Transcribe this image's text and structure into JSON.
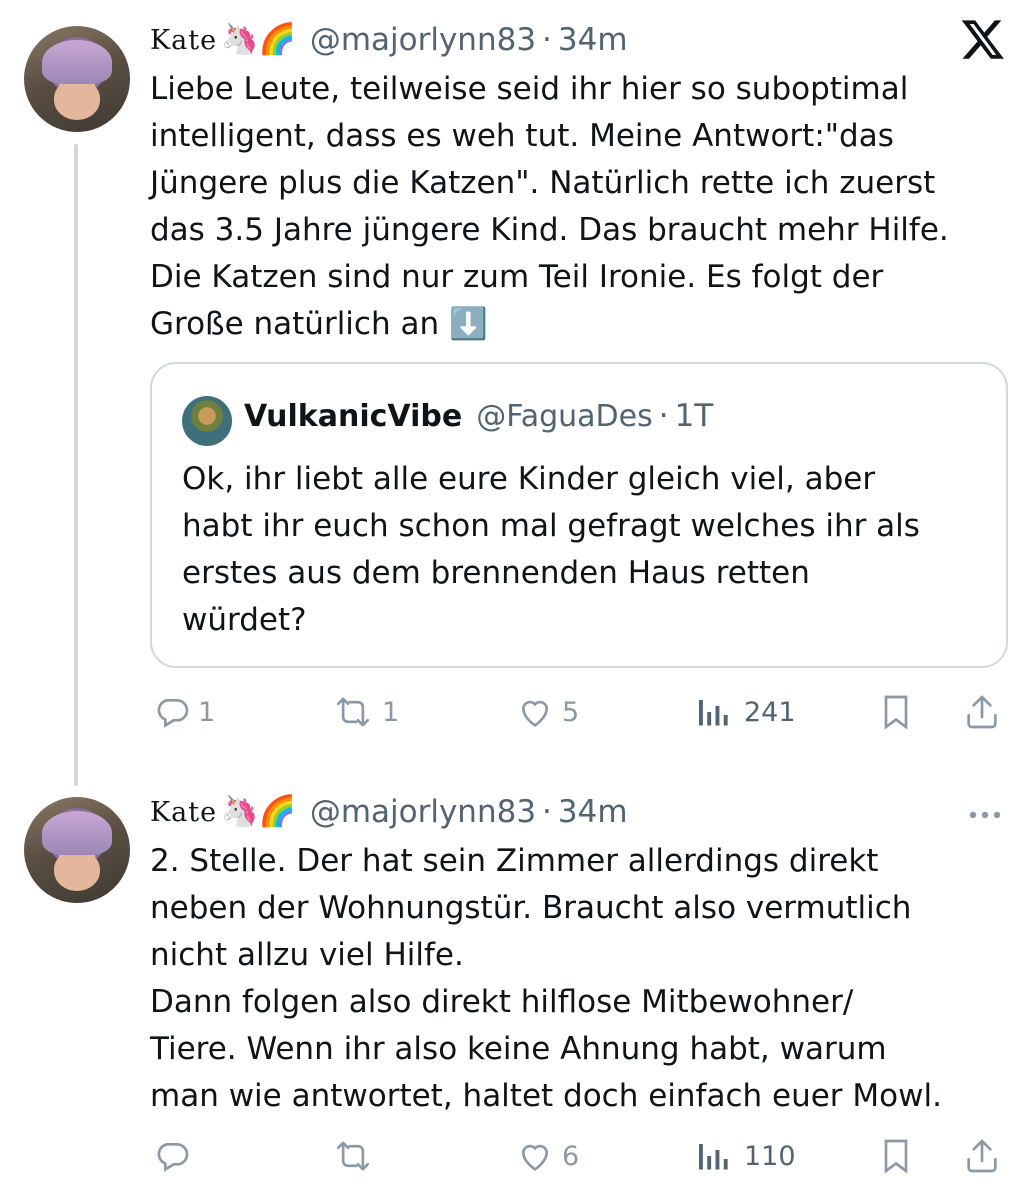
{
  "brand": {
    "logo_icon": "x-logo-icon"
  },
  "tweets": [
    {
      "author_name": "Kate",
      "author_emojis": "🦄🌈",
      "handle": "@majorlynn83",
      "separator": "·",
      "time": "34m",
      "text": "Liebe Leute, teilweise seid ihr hier so suboptimal\nintelligent, dass es weh tut. Meine Antwort:\"das\nJüngere plus die Katzen\". Natürlich rette ich zuerst\ndas 3.5 Jahre jüngere Kind. Das braucht mehr Hilfe.\nDie Katzen sind nur zum Teil Ironie. Es folgt der\nGroße natürlich an ⬇️",
      "quote": {
        "author_name": "VulkanicVibe",
        "handle": "@FaguaDes",
        "separator": "·",
        "time": "1T",
        "text": "Ok, ihr liebt alle eure Kinder gleich viel, aber\nhabt ihr euch schon mal gefragt welches ihr als\nerstes aus dem brennenden Haus retten\nwürdet?"
      },
      "actions": {
        "replies": "1",
        "reposts": "1",
        "likes": "5",
        "views": "241"
      }
    },
    {
      "author_name": "Kate",
      "author_emojis": "🦄🌈",
      "handle": "@majorlynn83",
      "separator": "·",
      "time": "34m",
      "text": "2. Stelle. Der hat sein Zimmer allerdings direkt\nneben der Wohnungstür. Braucht also vermutlich\nnicht allzu viel Hilfe.\nDann folgen also direkt hilflose Mitbewohner/\nTiere. Wenn ihr also keine Ahnung habt, warum\nman wie antwortet, haltet doch einfach euer Mowl.",
      "actions": {
        "replies": "",
        "reposts": "",
        "likes": "6",
        "views": "110"
      }
    }
  ],
  "colors": {
    "text": "#0f1419",
    "secondary": "#536471",
    "icon": "#8b98a5",
    "border": "#cfd9de"
  }
}
